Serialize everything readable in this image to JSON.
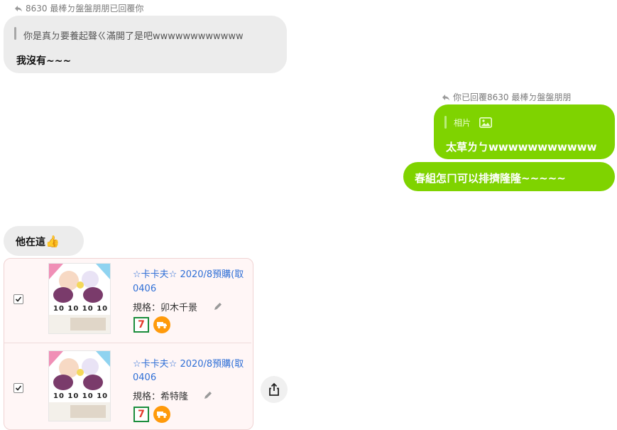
{
  "msg1": {
    "reply_header": "8630 最棒ㄉ盤盤朋朋已回覆你",
    "quoted": "你是真ㄉ要養起聲ㄍ滿開了是吧wwwwwwwwwwww",
    "text": "我沒有~~~"
  },
  "msg2": {
    "reply_header": "你已回覆8630 最棒ㄉ盤盤朋朋",
    "quoted": "相片",
    "text": "太草ㄌㄅwwwwwwwwwww"
  },
  "msg3": {
    "text": "春組怎ㄇ可以排擠隆隆~~~~~"
  },
  "msg4": {
    "text": "他在這",
    "emoji": "👍"
  },
  "products": [
    {
      "title": "☆卡卡夫☆ 2020/8預購(取",
      "code": "0406",
      "spec": "規格：卯木千景",
      "checked": true,
      "thumb_label": "10 10 10 10"
    },
    {
      "title": "☆卡卡夫☆ 2020/8預購(取",
      "code": "0406",
      "spec": "規格：希特隆",
      "checked": true,
      "thumb_label": "10 10 10 10"
    }
  ],
  "badges": {
    "seven_eleven": "7"
  },
  "icons": {
    "reply": "reply-arrow-icon",
    "photo": "image-icon",
    "edit": "pencil-icon",
    "share": "share-icon",
    "truck": "delivery-truck-icon",
    "checkbox": "checkmark-icon"
  },
  "colors": {
    "green_bubble": "#7fd300",
    "grey_bubble": "#ececec",
    "card_bg": "#fff6f6",
    "link_blue": "#2f6fd6"
  }
}
